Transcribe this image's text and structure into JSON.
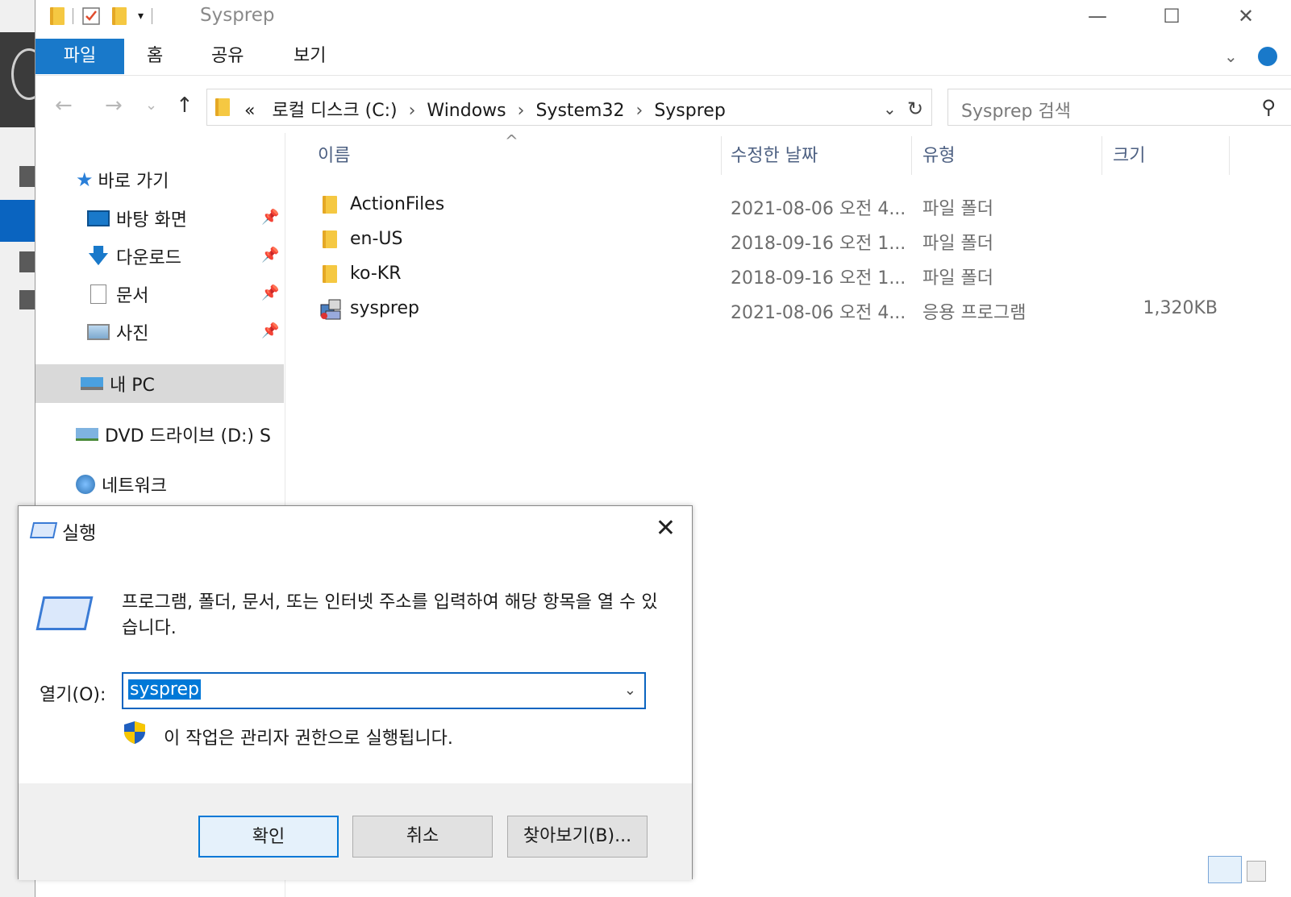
{
  "window": {
    "title": "Sysprep",
    "minimize_icon": "minimize-icon",
    "maximize_icon": "maximize-icon",
    "close_icon": "close-icon"
  },
  "ribbon": {
    "tabs": [
      "파일",
      "홈",
      "공유",
      "보기"
    ]
  },
  "navigation": {
    "back": "←",
    "forward": "→",
    "recent": "⌄",
    "up": "↑",
    "address_prefix": "«",
    "path": [
      "로컬 디스크 (C:)",
      "Windows",
      "System32",
      "Sysprep"
    ],
    "search_placeholder": "Sysprep 검색"
  },
  "nav_pane": {
    "quick_access": "바로 가기",
    "items": [
      {
        "label": "바탕 화면",
        "pinned": true
      },
      {
        "label": "다운로드",
        "pinned": true
      },
      {
        "label": "문서",
        "pinned": true
      },
      {
        "label": "사진",
        "pinned": true
      }
    ],
    "this_pc": "내 PC",
    "dvd": "DVD 드라이브 (D:) S",
    "network": "네트워크"
  },
  "file_list": {
    "columns": {
      "name": "이름",
      "date": "수정한 날짜",
      "type": "유형",
      "size": "크기"
    },
    "rows": [
      {
        "name": "ActionFiles",
        "date": "2021-08-06 오전 4...",
        "type": "파일 폴더",
        "size": "",
        "icon": "folder-icon"
      },
      {
        "name": "en-US",
        "date": "2018-09-16 오전 1...",
        "type": "파일 폴더",
        "size": "",
        "icon": "folder-icon"
      },
      {
        "name": "ko-KR",
        "date": "2018-09-16 오전 1...",
        "type": "파일 폴더",
        "size": "",
        "icon": "folder-icon"
      },
      {
        "name": "sysprep",
        "date": "2021-08-06 오전 4...",
        "type": "응용 프로그램",
        "size": "1,320KB",
        "icon": "application-icon"
      }
    ]
  },
  "run_dialog": {
    "title": "실행",
    "description": "프로그램, 폴더, 문서, 또는 인터넷 주소를 입력하여 해당 항목을 열 수 있습니다.",
    "open_label": "열기(O):",
    "open_value": "sysprep",
    "admin_note": "이 작업은 관리자 권한으로 실행됩니다.",
    "ok": "확인",
    "cancel": "취소",
    "browse": "찾아보기(B)..."
  },
  "colors": {
    "accent": "#1979ca",
    "selection": "#0078d7",
    "header_text": "#4d6082"
  }
}
